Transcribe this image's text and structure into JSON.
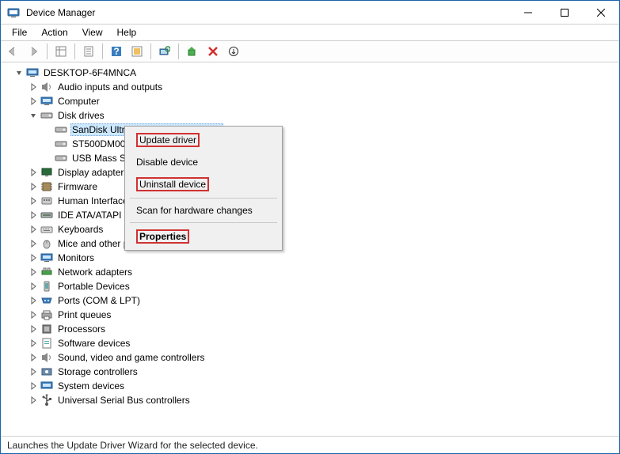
{
  "window": {
    "title": "Device Manager"
  },
  "menu": {
    "file": "File",
    "action": "Action",
    "view": "View",
    "help": "Help"
  },
  "tree": {
    "root": "DESKTOP-6F4MNCA",
    "audio": "Audio inputs and outputs",
    "computer": "Computer",
    "disk_drives": "Disk drives",
    "disk_sandisk": "SanDisk Ultra  USB 3.0 USB Device",
    "disk_st500": "ST500DM002",
    "disk_usbmass": "USB Mass  St",
    "display": "Display adapters",
    "firmware": "Firmware",
    "hid": "Human Interface",
    "ide": "IDE ATA/ATAPI c",
    "keyboards": "Keyboards",
    "mice": "Mice and other pointing devices",
    "monitors": "Monitors",
    "network": "Network adapters",
    "portable": "Portable Devices",
    "ports": "Ports (COM & LPT)",
    "printq": "Print queues",
    "processors": "Processors",
    "software": "Software devices",
    "sound": "Sound, video and game controllers",
    "storage": "Storage controllers",
    "system": "System devices",
    "usb": "Universal Serial Bus controllers"
  },
  "context": {
    "update": "Update driver",
    "disable": "Disable device",
    "uninstall": "Uninstall device",
    "scan": "Scan for hardware changes",
    "properties": "Properties"
  },
  "status": "Launches the Update Driver Wizard for the selected device."
}
